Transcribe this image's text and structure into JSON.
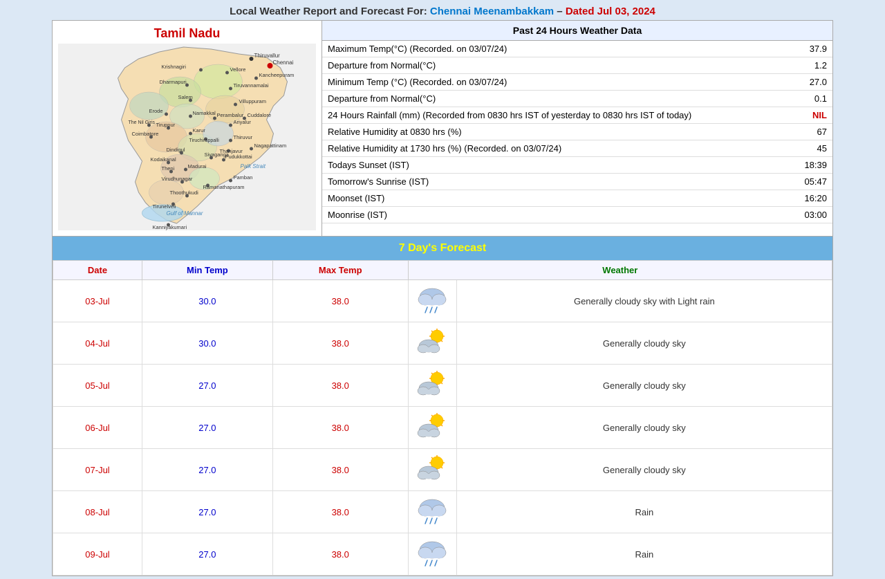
{
  "header": {
    "prefix": "Local Weather Report and Forecast For: ",
    "location": "Chennai Meenambakkam",
    "separator": " – ",
    "dated": "Dated Jul 03, 2024"
  },
  "past24": {
    "title": "Past 24 Hours Weather Data",
    "rows": [
      {
        "label": "Maximum Temp(°C) (Recorded. on 03/07/24)",
        "value": "37.9",
        "special": false
      },
      {
        "label": "Departure from Normal(°C)",
        "value": "1.2",
        "special": false
      },
      {
        "label": "Minimum Temp (°C) (Recorded. on 03/07/24)",
        "value": "27.0",
        "special": false
      },
      {
        "label": "Departure from Normal(°C)",
        "value": "0.1",
        "special": false
      },
      {
        "label": "24 Hours Rainfall (mm) (Recorded from 0830 hrs IST of yesterday to 0830 hrs IST of today)",
        "value": "NIL",
        "special": true
      },
      {
        "label": "Relative Humidity at 0830 hrs (%)",
        "value": "67",
        "special": false
      },
      {
        "label": "Relative Humidity at 1730 hrs (%) (Recorded. on 03/07/24)",
        "value": "45",
        "special": false
      },
      {
        "label": "Todays Sunset (IST)",
        "value": "18:39",
        "special": false
      },
      {
        "label": "Tomorrow's Sunrise (IST)",
        "value": "05:47",
        "special": false
      },
      {
        "label": "Moonset (IST)",
        "value": "16:20",
        "special": false
      },
      {
        "label": "Moonrise (IST)",
        "value": "03:00",
        "special": false
      }
    ]
  },
  "forecast": {
    "title": "7 Day's Forecast",
    "columns": {
      "date": "Date",
      "minTemp": "Min Temp",
      "maxTemp": "Max Temp",
      "weather": "Weather"
    },
    "rows": [
      {
        "date": "03-Jul",
        "minTemp": "30.0",
        "maxTemp": "38.0",
        "iconType": "rain",
        "description": "Generally cloudy sky with Light rain"
      },
      {
        "date": "04-Jul",
        "minTemp": "30.0",
        "maxTemp": "38.0",
        "iconType": "cloudy-sun",
        "description": "Generally cloudy sky"
      },
      {
        "date": "05-Jul",
        "minTemp": "27.0",
        "maxTemp": "38.0",
        "iconType": "cloudy-sun",
        "description": "Generally cloudy sky"
      },
      {
        "date": "06-Jul",
        "minTemp": "27.0",
        "maxTemp": "38.0",
        "iconType": "cloudy-sun",
        "description": "Generally cloudy sky"
      },
      {
        "date": "07-Jul",
        "minTemp": "27.0",
        "maxTemp": "38.0",
        "iconType": "cloudy-sun",
        "description": "Generally cloudy sky"
      },
      {
        "date": "08-Jul",
        "minTemp": "27.0",
        "maxTemp": "38.0",
        "iconType": "rain",
        "description": "Rain"
      },
      {
        "date": "09-Jul",
        "minTemp": "27.0",
        "maxTemp": "38.0",
        "iconType": "rain",
        "description": "Rain"
      }
    ]
  },
  "map": {
    "title": "Tamil Nadu"
  }
}
